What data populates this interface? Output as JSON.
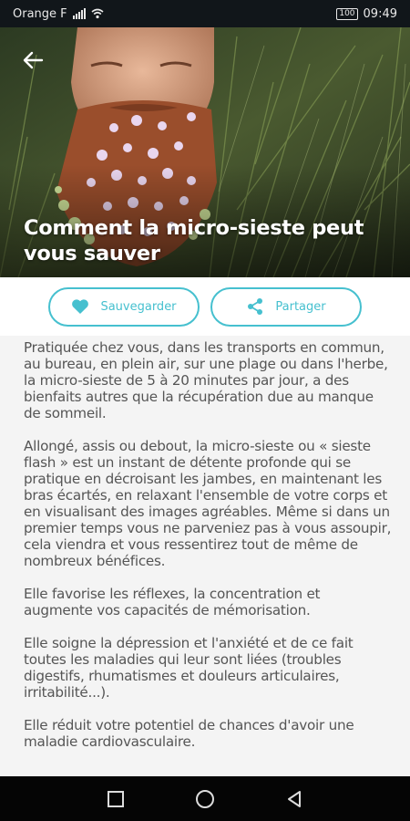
{
  "status_bar": {
    "carrier": "Orange F",
    "battery": "100",
    "time": "09:49"
  },
  "article": {
    "title": "Comment la micro-sieste peut vous sauver",
    "paragraphs": [
      "Pratiquée chez vous, dans les transports en commun, au bureau, en plein air, sur une plage ou dans l'herbe, la micro-sieste de 5 à 20 minutes par jour, a des bienfaits autres que la récupération due au manque de sommeil.",
      "Allongé, assis ou debout, la micro-sieste ou « sieste flash » est un instant de détente profonde qui se pratique en décroisant les jambes, en maintenant les bras écartés, en relaxant l'ensemble de votre corps et en visualisant des images agréables. Même si dans un premier temps vous ne parveniez pas à vous assoupir, cela viendra et vous ressentirez tout de même de nombreux bénéfices.",
      "Elle favorise les réflexes, la concentration et augmente vos capacités de mémorisation.",
      "Elle soigne la dépression et l'anxiété et de ce fait toutes les maladies qui leur sont liées (troubles digestifs, rhumatismes et douleurs articulaires, irritabilité...).",
      "Elle réduit votre potentiel de chances d'avoir une maladie cardiovasculaire."
    ]
  },
  "actions": {
    "save_label": "Sauvegarder",
    "share_label": "Partager"
  },
  "colors": {
    "accent": "#46c0cf",
    "text": "#555555"
  },
  "icons": {
    "back": "arrow-left-icon",
    "save": "heart-icon",
    "share": "share-icon"
  }
}
